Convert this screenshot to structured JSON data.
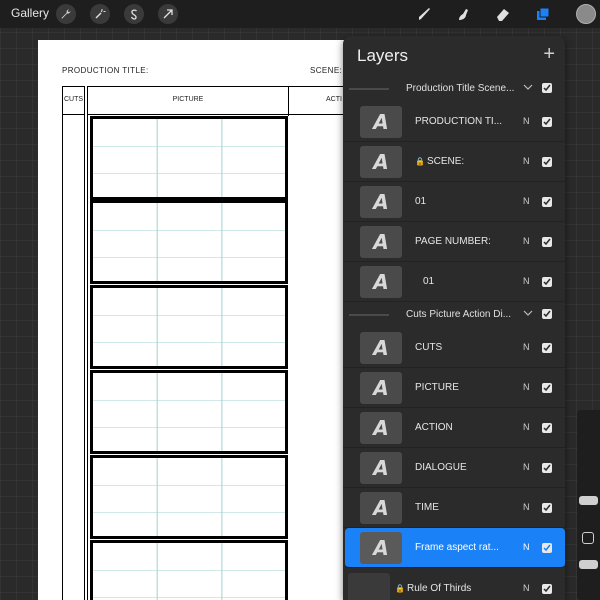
{
  "toolbar": {
    "gallery_label": "Gallery",
    "left_tools": [
      "wrench-icon",
      "magic-wand-icon",
      "selection-s-icon",
      "transform-arrow-icon"
    ],
    "right_tools": [
      "brush-icon",
      "smudge-icon",
      "eraser-icon",
      "layers-icon"
    ],
    "active_tool": "layers-icon",
    "accent_color": "#1a82f6",
    "current_color": "#8a8a8a"
  },
  "canvas": {
    "production_title_label": "PRODUCTION TITLE:",
    "scene_label": "SCENE:",
    "columns": {
      "cuts": "CUTS",
      "picture": "PICTURE",
      "action": "ACTI"
    },
    "frame_grid_color": "#9fd3cf"
  },
  "layers": {
    "title": "Layers",
    "add_icon": "plus-icon",
    "groups": [
      {
        "name": "Production Title Scene...",
        "visible": true,
        "layers": [
          {
            "name": "PRODUCTION TI...",
            "blend": "N",
            "visible": true,
            "locked": false
          },
          {
            "name": "SCENE:",
            "blend": "N",
            "visible": true,
            "locked": true
          },
          {
            "name": "01",
            "blend": "N",
            "visible": true,
            "locked": false
          },
          {
            "name": "PAGE NUMBER:",
            "blend": "N",
            "visible": true,
            "locked": false
          },
          {
            "name": "01",
            "blend": "N",
            "visible": true,
            "locked": false
          }
        ]
      },
      {
        "name": "Cuts Picture Action Di...",
        "visible": true,
        "layers": [
          {
            "name": "CUTS",
            "blend": "N",
            "visible": true,
            "locked": false
          },
          {
            "name": "PICTURE",
            "blend": "N",
            "visible": true,
            "locked": false
          },
          {
            "name": "ACTION",
            "blend": "N",
            "visible": true,
            "locked": false
          },
          {
            "name": "DIALOGUE",
            "blend": "N",
            "visible": true,
            "locked": false
          },
          {
            "name": "TIME",
            "blend": "N",
            "visible": true,
            "locked": false
          }
        ]
      }
    ],
    "ungrouped": [
      {
        "name": "Frame aspect rat...",
        "blend": "N",
        "visible": true,
        "locked": false,
        "selected": true
      },
      {
        "name": "Rule Of Thirds",
        "blend": "N",
        "visible": true,
        "locked": true
      }
    ]
  }
}
